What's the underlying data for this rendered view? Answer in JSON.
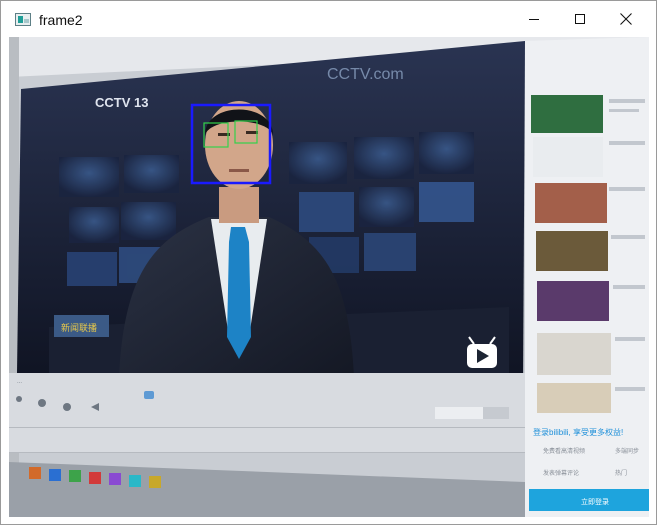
{
  "window": {
    "title": "frame2",
    "controls": {
      "minimize": "minimize",
      "maximize": "maximize",
      "close": "close"
    }
  },
  "frame": {
    "channel_logo": "CCTV 13",
    "background_logo": "CCTV.com",
    "right_panel": {
      "header_prompt": "登录bilibili, 享受更多权益!",
      "login_button": "立即登录",
      "side_items": [
        "免费看高清视频",
        "多端同步",
        "发表弹幕评论",
        "热门"
      ]
    },
    "detections": {
      "face": {
        "color": "#1a1aff",
        "label": "face"
      },
      "eyes": {
        "color": "#33d24a",
        "label": "eye"
      }
    },
    "player_bar": {
      "play_icon": "tv-icon"
    }
  }
}
